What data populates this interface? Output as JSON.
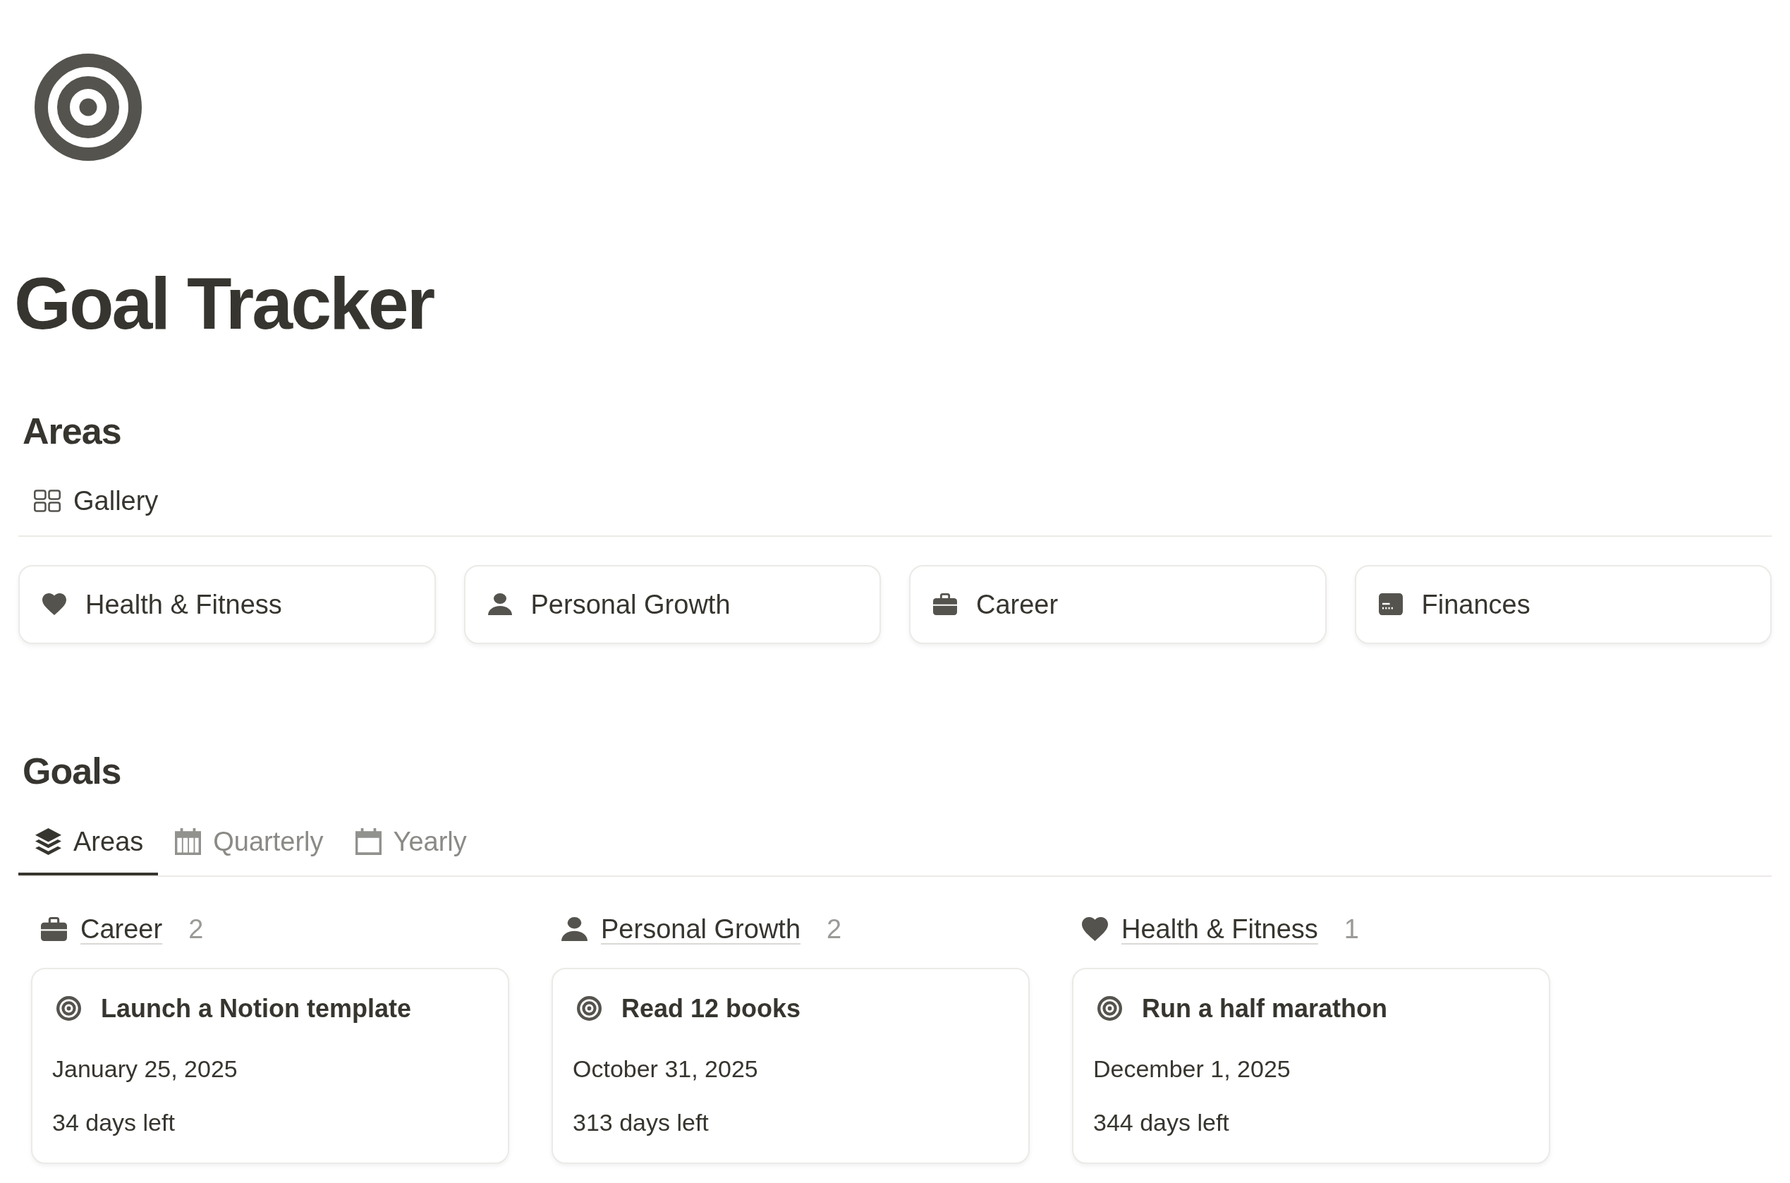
{
  "page": {
    "title": "Goal Tracker"
  },
  "areas": {
    "heading": "Areas",
    "view": {
      "label": "Gallery"
    },
    "cards": [
      {
        "name": "Health & Fitness"
      },
      {
        "name": "Personal Growth"
      },
      {
        "name": "Career"
      },
      {
        "name": "Finances"
      }
    ]
  },
  "goals": {
    "heading": "Goals",
    "tabs": [
      {
        "label": "Areas",
        "selected": true
      },
      {
        "label": "Quarterly",
        "selected": false
      },
      {
        "label": "Yearly",
        "selected": false
      }
    ],
    "columns": [
      {
        "title": "Career",
        "count": "2",
        "cards": [
          {
            "title": "Launch a Notion template",
            "date": "January 25, 2025",
            "remaining": "34 days left"
          }
        ]
      },
      {
        "title": "Personal Growth",
        "count": "2",
        "cards": [
          {
            "title": "Read 12 books",
            "date": "October 31, 2025",
            "remaining": "313 days left"
          }
        ]
      },
      {
        "title": "Health & Fitness",
        "count": "1",
        "cards": [
          {
            "title": "Run a half marathon",
            "date": "December 1, 2025",
            "remaining": "344 days left"
          }
        ]
      }
    ]
  }
}
